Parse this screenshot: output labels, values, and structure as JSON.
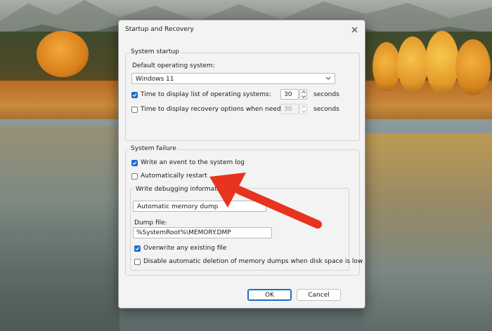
{
  "window": {
    "title": "Startup and Recovery",
    "close_icon": "close-icon"
  },
  "system_startup": {
    "group_label": "System startup",
    "default_os_label": "Default operating system:",
    "default_os_value": "Windows 11",
    "display_list": {
      "label": "Time to display list of operating systems:",
      "checked": true,
      "value": "30",
      "unit": "seconds"
    },
    "display_recovery": {
      "label": "Time to display recovery options when needed:",
      "checked": false,
      "value": "30",
      "unit": "seconds"
    }
  },
  "system_failure": {
    "group_label": "System failure",
    "write_event": {
      "label": "Write an event to the system log",
      "checked": true
    },
    "auto_restart": {
      "label": "Automatically restart",
      "checked": false
    },
    "debug": {
      "group_label": "Write debugging information",
      "dump_type_value": "Automatic memory dump",
      "dump_file_label": "Dump file:",
      "dump_file_value": "%SystemRoot%\\MEMORY.DMP",
      "overwrite": {
        "label": "Overwrite any existing file",
        "checked": true
      },
      "disable_auto_delete": {
        "label": "Disable automatic deletion of memory dumps when disk space is low",
        "checked": false
      }
    }
  },
  "buttons": {
    "ok_label": "OK",
    "cancel_label": "Cancel"
  },
  "colors": {
    "accent": "#1a6fc7",
    "annotation_arrow": "#e8331f",
    "dialog_bg": "#f3f3f3"
  }
}
